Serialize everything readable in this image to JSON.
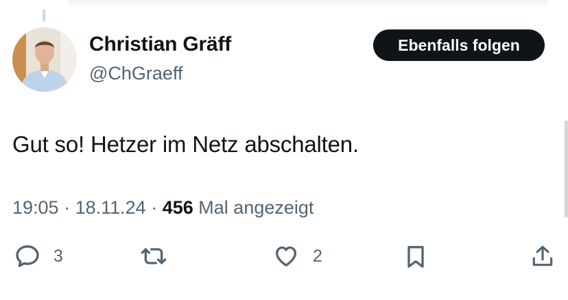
{
  "author": {
    "name": "Christian Gräff",
    "handle": "@ChGraeff"
  },
  "follow_button_label": "Ebenfalls folgen",
  "tweet": {
    "text": "Gut so! Hetzer im Netz abschalten.",
    "time": "19:05",
    "date": "18.11.24",
    "views_count": "456",
    "views_label": "Mal angezeigt"
  },
  "actions": {
    "reply_count": "3",
    "like_count": "2"
  },
  "icons": [
    "reply-icon",
    "repost-icon",
    "like-icon",
    "bookmark-icon",
    "share-icon"
  ],
  "colors": {
    "text": "#0f1419",
    "secondary": "#536471",
    "button_bg": "#0f1419"
  }
}
